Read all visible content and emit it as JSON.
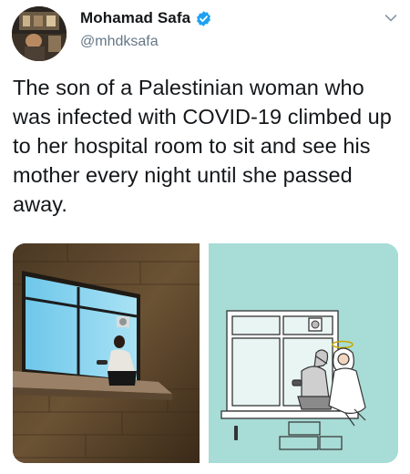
{
  "tweet": {
    "author": {
      "display_name": "Mohamad Safa",
      "handle": "@mhdksafa",
      "verified": true,
      "avatar_icon": "profile-photo",
      "verified_icon": "verified-badge-icon"
    },
    "menu_icon": "chevron-down-icon",
    "text": "The son of a Palestinian woman who was infected with COVID-19 climbed up to her hospital room to sit and see his mother every night until she passed away.",
    "media": [
      {
        "kind": "photo",
        "subject": "man sitting on hospital window ledge at night"
      },
      {
        "kind": "illustration",
        "subject": "cartoon of son on ledge with mother as angel"
      }
    ]
  },
  "colors": {
    "verified_blue": "#1da1f2",
    "handle_gray": "#657786",
    "cartoon_bg": "#a8dcd6"
  }
}
